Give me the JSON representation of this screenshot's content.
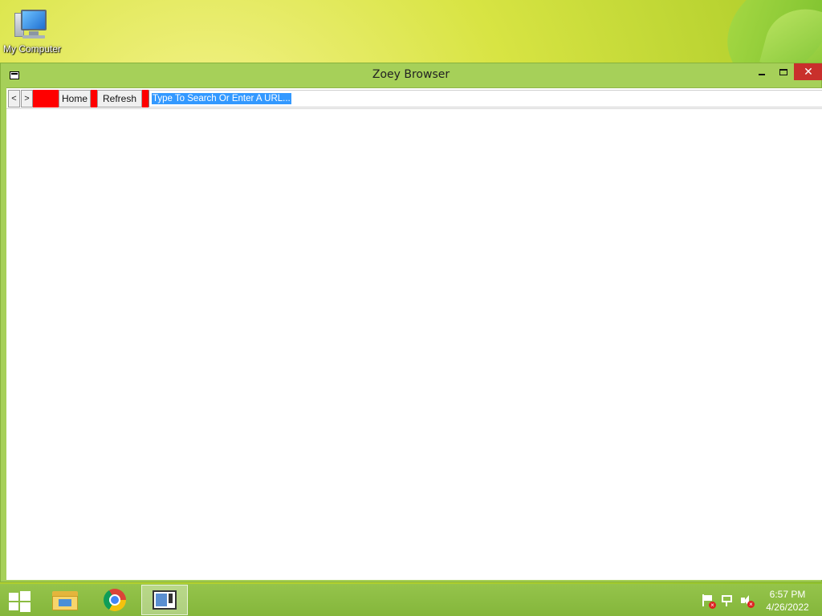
{
  "desktop": {
    "icons": [
      {
        "label": "My Computer",
        "icon": "computer-icon"
      }
    ]
  },
  "window": {
    "title": "Zoey Browser",
    "controls": {
      "minimize": "minimize",
      "maximize": "maximize",
      "close": "✕"
    },
    "toolbar": {
      "back_label": "<",
      "forward_label": ">",
      "home_label": "Home",
      "refresh_label": "Refresh",
      "url_value": "Type To Search Or Enter A URL..."
    }
  },
  "taskbar": {
    "apps": [
      {
        "name": "File Explorer",
        "icon": "folder-icon"
      },
      {
        "name": "Google Chrome",
        "icon": "chrome-icon"
      },
      {
        "name": "Zoey Browser",
        "icon": "app-window-icon",
        "active": true
      }
    ],
    "tray": {
      "icons": [
        "action-center-flag-icon",
        "network-icon",
        "volume-muted-icon"
      ],
      "time": "6:57 PM",
      "date": "4/26/2022"
    }
  },
  "colors": {
    "window_frame": "#a6d059",
    "close_button": "#c9302c",
    "accent_red": "#ff0000",
    "selection": "#3399ff",
    "taskbar": "#8cbd43"
  }
}
